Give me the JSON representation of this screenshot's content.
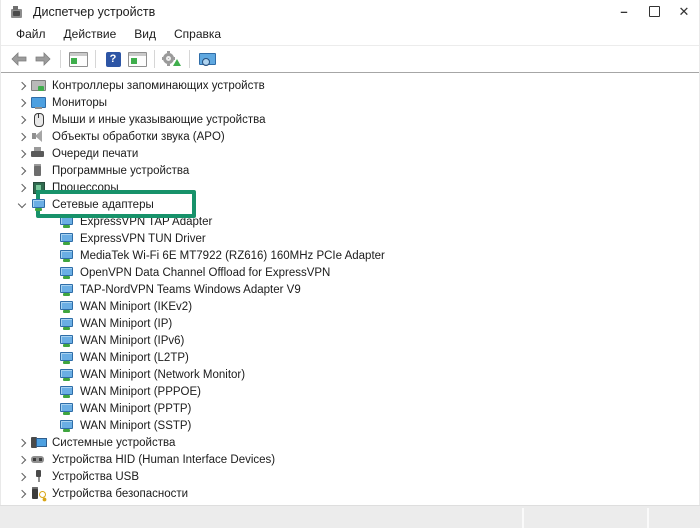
{
  "window": {
    "title": "Диспетчер устройств",
    "controls": {
      "minimize": "–",
      "maximize": "",
      "close": "✕"
    }
  },
  "menu": {
    "items": [
      {
        "label": "Файл"
      },
      {
        "label": "Действие"
      },
      {
        "label": "Вид"
      },
      {
        "label": "Справка"
      }
    ]
  },
  "toolbar": {
    "icons": [
      "back-arrow",
      "forward-arrow",
      "show-console-tree",
      "help",
      "show-action-pane",
      "scan-hardware-changes",
      "computer-view"
    ],
    "help_glyph": "?"
  },
  "accent": {
    "highlight_border": "#17926a"
  },
  "tree": {
    "items": [
      {
        "label": "Контроллеры запоминающих устройств",
        "icon": "storage-icon",
        "level": 0,
        "state": "collapsed"
      },
      {
        "label": "Мониторы",
        "icon": "monitor-icon",
        "level": 0,
        "state": "collapsed"
      },
      {
        "label": "Мыши и иные указывающие устройства",
        "icon": "mouse-icon",
        "level": 0,
        "state": "collapsed"
      },
      {
        "label": "Объекты обработки звука (APO)",
        "icon": "audio-icon",
        "level": 0,
        "state": "collapsed"
      },
      {
        "label": "Очереди печати",
        "icon": "printer-icon",
        "level": 0,
        "state": "collapsed"
      },
      {
        "label": "Программные устройства",
        "icon": "software-icon",
        "level": 0,
        "state": "collapsed"
      },
      {
        "label": "Процессоры",
        "icon": "cpu-icon",
        "level": 0,
        "state": "collapsed"
      },
      {
        "label": "Сетевые адаптеры",
        "icon": "network-adapter-icon",
        "level": 0,
        "state": "expanded",
        "highlighted": true
      },
      {
        "label": "ExpressVPN TAP Adapter",
        "icon": "network-adapter-icon",
        "level": 1
      },
      {
        "label": "ExpressVPN TUN Driver",
        "icon": "network-adapter-icon",
        "level": 1
      },
      {
        "label": "MediaTek Wi-Fi 6E MT7922 (RZ616) 160MHz PCIe Adapter",
        "icon": "network-adapter-icon",
        "level": 1
      },
      {
        "label": "OpenVPN Data Channel Offload for ExpressVPN",
        "icon": "network-adapter-icon",
        "level": 1
      },
      {
        "label": "TAP-NordVPN Teams Windows Adapter V9",
        "icon": "network-adapter-icon",
        "level": 1
      },
      {
        "label": "WAN Miniport (IKEv2)",
        "icon": "network-adapter-icon",
        "level": 1
      },
      {
        "label": "WAN Miniport (IP)",
        "icon": "network-adapter-icon",
        "level": 1
      },
      {
        "label": "WAN Miniport (IPv6)",
        "icon": "network-adapter-icon",
        "level": 1
      },
      {
        "label": "WAN Miniport (L2TP)",
        "icon": "network-adapter-icon",
        "level": 1
      },
      {
        "label": "WAN Miniport (Network Monitor)",
        "icon": "network-adapter-icon",
        "level": 1
      },
      {
        "label": "WAN Miniport (PPPOE)",
        "icon": "network-adapter-icon",
        "level": 1
      },
      {
        "label": "WAN Miniport (PPTP)",
        "icon": "network-adapter-icon",
        "level": 1
      },
      {
        "label": "WAN Miniport (SSTP)",
        "icon": "network-adapter-icon",
        "level": 1
      },
      {
        "label": "Системные устройства",
        "icon": "system-icon",
        "level": 0,
        "state": "collapsed"
      },
      {
        "label": "Устройства HID (Human Interface Devices)",
        "icon": "hid-icon",
        "level": 0,
        "state": "collapsed"
      },
      {
        "label": "Устройства USB",
        "icon": "usb-icon",
        "level": 0,
        "state": "collapsed"
      },
      {
        "label": "Устройства безопасности",
        "icon": "security-icon",
        "level": 0,
        "state": "collapsed"
      }
    ]
  }
}
